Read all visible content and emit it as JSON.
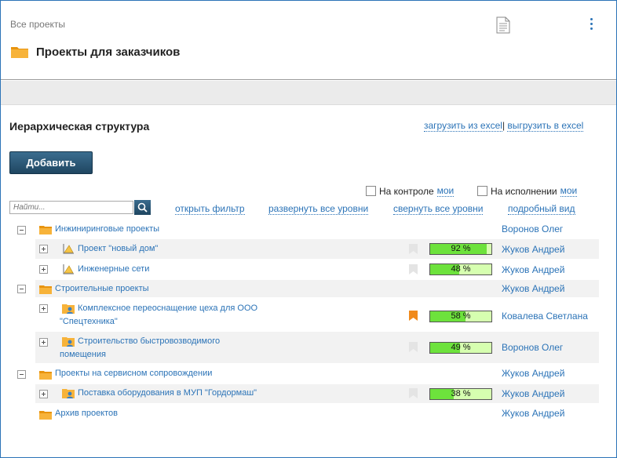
{
  "header": {
    "breadcrumb": "Все проекты",
    "title": "Проекты для заказчиков"
  },
  "section": {
    "title": "Иерархическая структура",
    "import_excel": "загрузить из excel",
    "separator": "|",
    "export_excel": "выгрузить в excel"
  },
  "toolbar": {
    "add_label": "Добавить",
    "search_placeholder": "Найти...",
    "on_control_label": "На контроле",
    "on_control_mine": "мои",
    "in_execution_label": "На исполнении",
    "in_execution_mine": "мои",
    "open_filter": "открыть фильтр",
    "expand_all": "развернуть все уровни",
    "collapse_all": "свернуть все уровни",
    "detailed_view": "подробный вид"
  },
  "tree": {
    "group1": {
      "name": "Инжиниринговые проекты",
      "owner": "Воронов Олег"
    },
    "p1": {
      "name": "Проект \"новый дом\"",
      "owner": "Жуков Андрей",
      "progress": 92,
      "progress_label": "92 %"
    },
    "p2": {
      "name": "Инженерные сети",
      "owner": "Жуков Андрей",
      "progress": 48,
      "progress_label": "48 %"
    },
    "group2": {
      "name": "Строительные проекты",
      "owner": "Жуков Андрей"
    },
    "p3": {
      "name_line1": "Комплексное переоснащение цеха для ООО",
      "name_line2": "\"Спецтехника\"",
      "owner": "Ковалева Светлана",
      "progress": 58,
      "progress_label": "58 %"
    },
    "p4": {
      "name_line1": "Строительство быстровозводимого",
      "name_line2": "помещения",
      "owner": "Воронов Олег",
      "progress": 49,
      "progress_label": "49 %"
    },
    "group3": {
      "name": "Проекты на сервисном сопровождении",
      "owner": "Жуков Андрей"
    },
    "p5": {
      "name": "Поставка оборудования в МУП \"Гордормаш\"",
      "owner": "Жуков Андрей",
      "progress": 38,
      "progress_label": "38 %"
    },
    "group4": {
      "name": "Архив проектов",
      "owner": "Жуков Андрей"
    }
  },
  "colors": {
    "link": "#2b73b7",
    "folder": "#f5a623",
    "progress_fill": "#6de23c",
    "progress_empty": "#d6ffb0",
    "flag_active": "#f08a1c",
    "flag_inactive": "#e4e4e4"
  }
}
